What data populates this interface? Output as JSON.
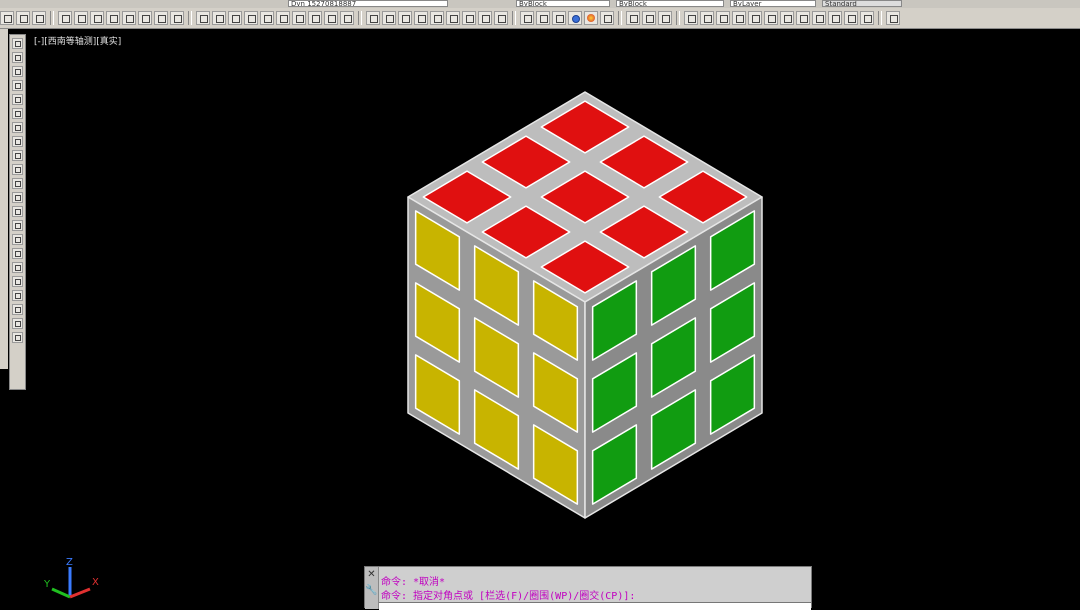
{
  "toolbar": {
    "layer_combo": "Dyn 15270818887",
    "color_combo": "ByBlock",
    "linetype_combo": "ByBlock",
    "lineweight_combo": "ByLayer",
    "plot_combo": "Standard"
  },
  "viewport": {
    "label": "[-][西南等轴测][真实]"
  },
  "ucs": {
    "x_label": "X",
    "y_label": "Y",
    "z_label": "Z"
  },
  "command": {
    "line1": "命令: *取消*",
    "line2": "命令: 指定对角点或 [栏选(F)/圈围(WP)/圈交(CP)]:",
    "close_icon": "close-icon",
    "wrench_icon": "wrench-icon"
  },
  "colors": {
    "top": "#e01010",
    "left": "#c8b400",
    "right": "#119c11",
    "frame": "#d0d0d0"
  }
}
